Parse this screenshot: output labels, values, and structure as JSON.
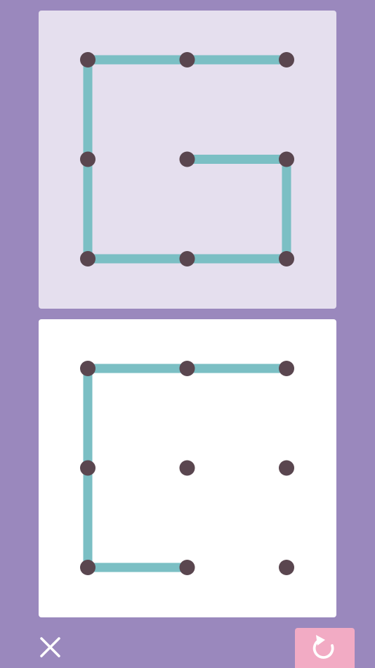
{
  "colors": {
    "background": "#9a88bd",
    "target_panel": "#e5dfee",
    "draw_panel": "#ffffff",
    "line": "#7bbfc4",
    "dot": "#5a464f",
    "reset_button": "#f2abc4",
    "icon": "#ffffff"
  },
  "grid": {
    "rows": 3,
    "cols": 3
  },
  "target_pattern": {
    "segments": [
      [
        [
          0,
          0
        ],
        [
          1,
          0
        ]
      ],
      [
        [
          1,
          0
        ],
        [
          2,
          0
        ]
      ],
      [
        [
          0,
          0
        ],
        [
          0,
          1
        ]
      ],
      [
        [
          0,
          1
        ],
        [
          0,
          2
        ]
      ],
      [
        [
          0,
          2
        ],
        [
          1,
          2
        ]
      ],
      [
        [
          1,
          2
        ],
        [
          2,
          2
        ]
      ],
      [
        [
          2,
          2
        ],
        [
          2,
          1
        ]
      ],
      [
        [
          2,
          1
        ],
        [
          1,
          1
        ]
      ]
    ]
  },
  "drawn_pattern": {
    "segments": [
      [
        [
          0,
          0
        ],
        [
          1,
          0
        ]
      ],
      [
        [
          1,
          0
        ],
        [
          2,
          0
        ]
      ],
      [
        [
          0,
          0
        ],
        [
          0,
          1
        ]
      ],
      [
        [
          0,
          1
        ],
        [
          0,
          2
        ]
      ],
      [
        [
          0,
          2
        ],
        [
          1,
          2
        ]
      ]
    ]
  },
  "controls": {
    "close_icon": "close-icon",
    "reset_icon": "reset-icon"
  }
}
